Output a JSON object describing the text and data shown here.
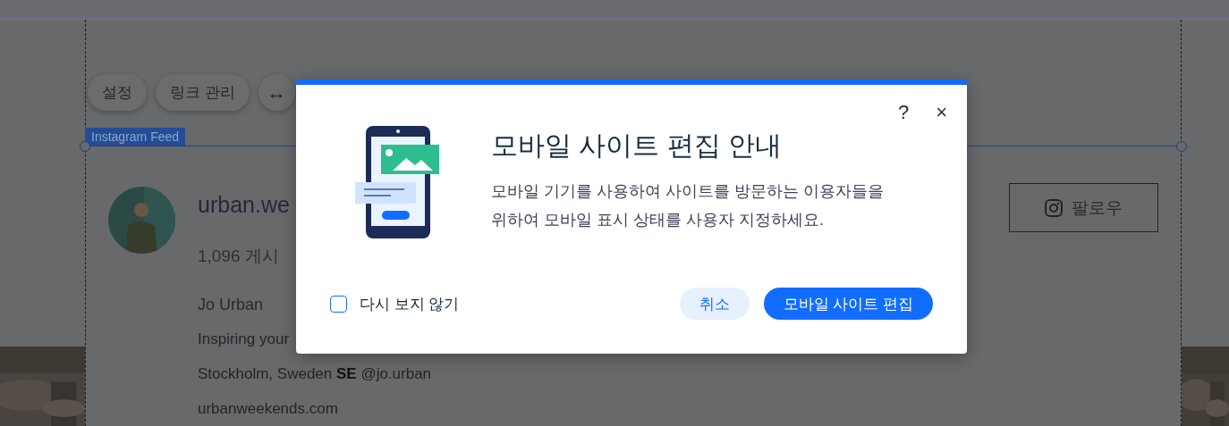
{
  "toolbar": [
    "설정",
    "링크 관리",
    "↔"
  ],
  "element_label": "Instagram Feed",
  "profile": {
    "username": "urban.we",
    "posts": "1,096 게시",
    "name": "Jo Urban",
    "bio": "Inspiring your",
    "location": "Stockholm, Sweden **SE** @jo.urban",
    "website": "urbanweekends.com",
    "follow": "팔로우"
  },
  "dialog": {
    "title": "모바일 사이트 편집 안내",
    "description": "모바일 기기를 사용하여 사이트를 방문하는 이용자들을 위하여 모바일 표시 상태를 사용자 지정하세요.",
    "help": "?",
    "close": "×",
    "checkbox": {
      "label": "다시 보지 않기",
      "checked": false
    },
    "buttons": [
      {
        "kind": "secondary",
        "label": "취소"
      },
      {
        "kind": "primary",
        "label": "모바일 사이트 편집"
      }
    ]
  }
}
